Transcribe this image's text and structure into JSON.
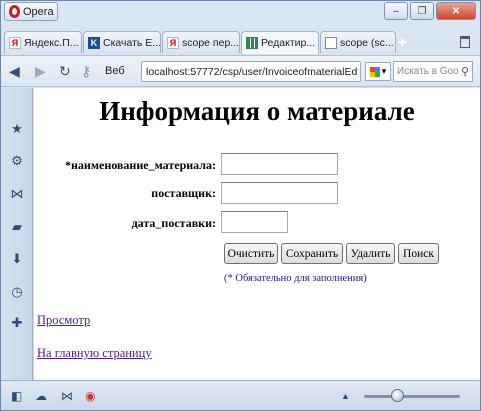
{
  "window": {
    "app_menu_label": "Opera",
    "controls": {
      "minimize": "–",
      "maximize": "❐",
      "close": "✕"
    }
  },
  "tabs": [
    {
      "label": "Яндекс.П...",
      "favicon": "yandex-icon"
    },
    {
      "label": "Скачать E...",
      "favicon": "k-icon"
    },
    {
      "label": "scope пер...",
      "favicon": "yandex-icon"
    },
    {
      "label": "Редактир...",
      "favicon": "grid-icon",
      "active": true
    },
    {
      "label": "scope (sc...",
      "favicon": "document-icon"
    }
  ],
  "navbar": {
    "web_label": "Веб",
    "url": "localhost:57772/csp/user/InvoiceofmaterialEd",
    "search_placeholder": "Искать в Goo"
  },
  "page": {
    "title": "Информация о материале",
    "fields": [
      {
        "label": "*наименование_материала:",
        "value": ""
      },
      {
        "label": "поставщик:",
        "value": ""
      },
      {
        "label": "дата_поставки:",
        "value": ""
      }
    ],
    "buttons": {
      "clear": "Очистить",
      "save": "Сохранить",
      "delete": "Удалить",
      "search": "Поиск"
    },
    "required_note": "(* Обязательно для заполнения)",
    "links": {
      "view": "Просмотр",
      "home": "На главную страницу"
    }
  },
  "statusbar": {
    "zoom_fraction": 0.34
  },
  "colors": {
    "link_visited": "#551a8b",
    "note_text": "#1a1a9c",
    "chrome_bg": "#dbe6f3"
  }
}
